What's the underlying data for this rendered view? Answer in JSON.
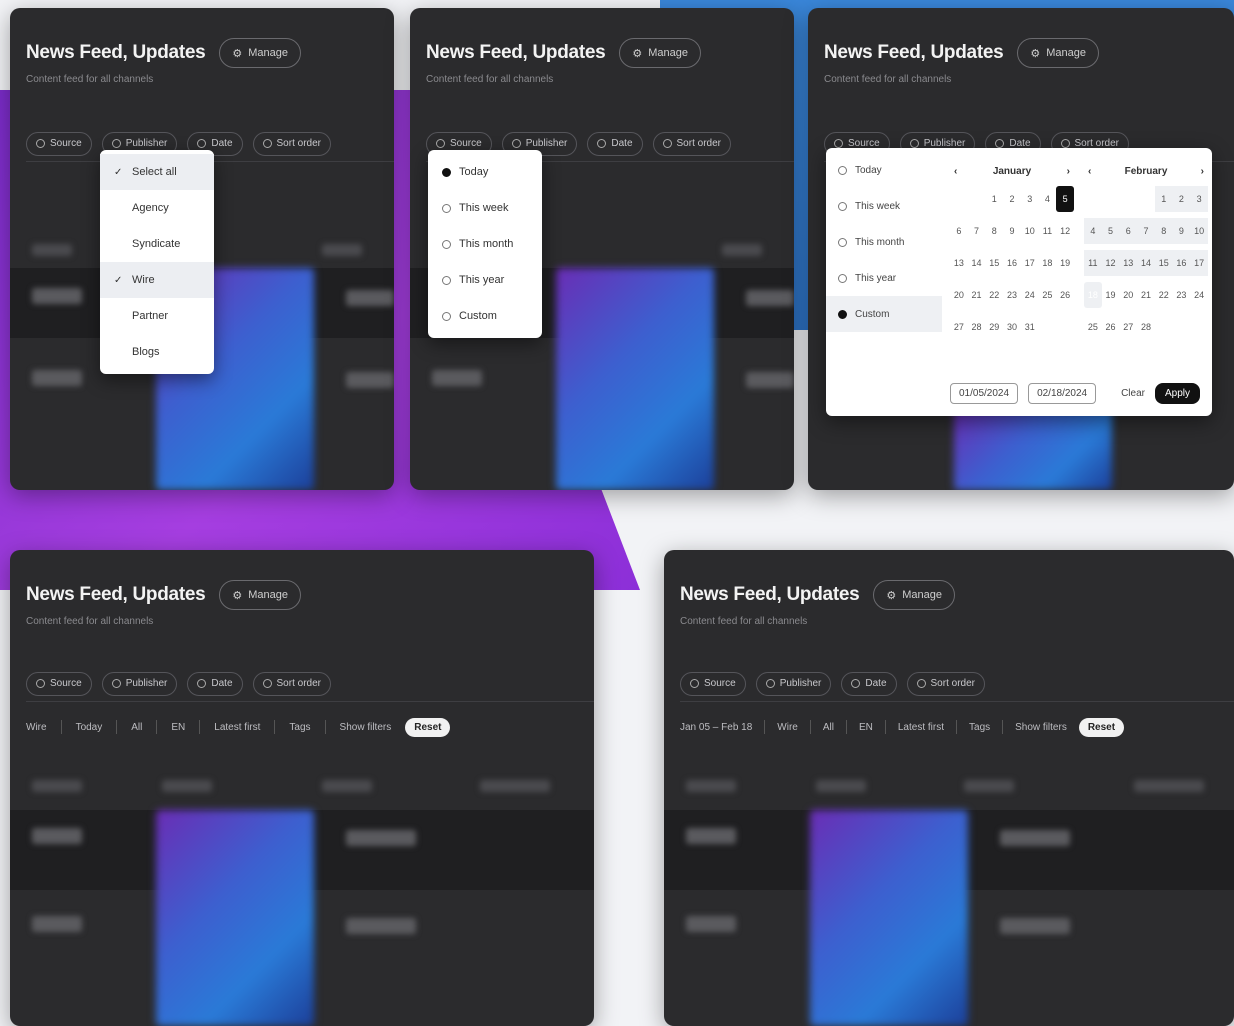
{
  "header": {
    "title": "News Feed, Updates",
    "manage_label": "Manage",
    "subtitle": "Content feed for all channels"
  },
  "filters": [
    {
      "label": "Source"
    },
    {
      "label": "Publisher"
    },
    {
      "label": "Date"
    },
    {
      "label": "Sort order"
    }
  ],
  "menu_publisher": {
    "items": [
      {
        "label": "Select all",
        "checked": true
      },
      {
        "label": "Agency"
      },
      {
        "label": "Syndicate"
      },
      {
        "label": "Wire",
        "checked": true
      },
      {
        "label": "Partner"
      },
      {
        "label": "Blogs"
      }
    ]
  },
  "menu_source": {
    "items": [
      {
        "label": "Today",
        "selected": true
      },
      {
        "label": "This week"
      },
      {
        "label": "This month"
      },
      {
        "label": "This year"
      },
      {
        "label": "Custom"
      }
    ]
  },
  "datepicker": {
    "presets": [
      "Today",
      "This week",
      "This month",
      "This year",
      "Custom"
    ],
    "month_left": "January",
    "month_right": "February",
    "left_days": [
      "",
      "",
      "1",
      "2",
      "3",
      "4",
      "5",
      "6",
      "7",
      "8",
      "9",
      "10",
      "11",
      "12",
      "13",
      "14",
      "15",
      "16",
      "17",
      "18",
      "19",
      "20",
      "21",
      "22",
      "23",
      "24",
      "25",
      "26",
      "27",
      "28",
      "29",
      "30",
      "31",
      "",
      ""
    ],
    "right_days": [
      "",
      "",
      "",
      "",
      "1",
      "2",
      "3",
      "4",
      "5",
      "6",
      "7",
      "8",
      "9",
      "10",
      "11",
      "12",
      "13",
      "14",
      "15",
      "16",
      "17",
      "18",
      "19",
      "20",
      "21",
      "22",
      "23",
      "24",
      "25",
      "26",
      "27",
      "28",
      "",
      "",
      ""
    ],
    "from_value": "01/05/2024",
    "to_value": "02/18/2024",
    "clear_label": "Clear",
    "apply_label": "Apply"
  },
  "summary_left": {
    "items": [
      "Wire",
      "Today",
      "All",
      "EN",
      "Latest first",
      "Tags",
      "Show filters"
    ],
    "pill": "Reset"
  },
  "summary_right": {
    "items": [
      "Jan 05 – Feb 18",
      "Wire",
      "All",
      "EN",
      "Latest first",
      "Tags",
      "Show filters"
    ],
    "pill": "Reset"
  }
}
